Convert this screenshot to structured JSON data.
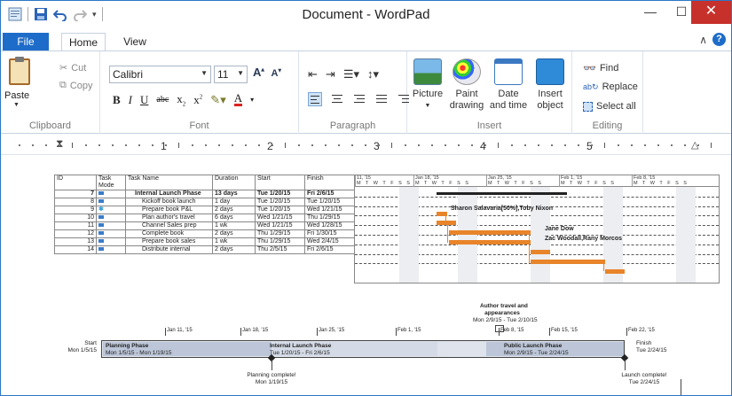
{
  "window": {
    "title": "Document - WordPad"
  },
  "tabs": {
    "file": "File",
    "home": "Home",
    "view": "View"
  },
  "ribbon": {
    "clipboard": {
      "label": "Clipboard",
      "paste": "Paste",
      "cut": "Cut",
      "copy": "Copy"
    },
    "font": {
      "label": "Font",
      "family": "Calibri",
      "size": "11"
    },
    "paragraph": {
      "label": "Paragraph"
    },
    "insert": {
      "label": "Insert",
      "picture": "Picture",
      "paint": "Paint drawing",
      "datetime": "Date and time",
      "object": "Insert object"
    },
    "editing": {
      "label": "Editing",
      "find": "Find",
      "replace": "Replace",
      "selectall": "Select all"
    }
  },
  "ruler": {
    "numbers": [
      "1",
      "2",
      "3",
      "4",
      "5"
    ]
  },
  "gantt": {
    "headers": [
      "ID",
      "Task Mode",
      "Task Name",
      "Duration",
      "Start",
      "Finish"
    ],
    "rows": [
      [
        "7",
        "",
        "Internal Launch Phase",
        "13 days",
        "Tue 1/20/15",
        "Fri 2/6/15"
      ],
      [
        "8",
        "",
        "Kickoff book launch",
        "1 day",
        "Tue 1/20/15",
        "Tue 1/20/15"
      ],
      [
        "9",
        "",
        "Prepare book P&L",
        "2 days",
        "Tue 1/20/15",
        "Wed 1/21/15"
      ],
      [
        "10",
        "",
        "Plan author's travel",
        "6 days",
        "Wed 1/21/15",
        "Thu 1/29/15"
      ],
      [
        "11",
        "",
        "Channel Sales prep",
        "1 wk",
        "Wed 1/21/15",
        "Wed 1/28/15"
      ],
      [
        "12",
        "",
        "Complete book",
        "2 days",
        "Thu 1/29/15",
        "Fri 1/30/15"
      ],
      [
        "13",
        "",
        "Prepare book sales",
        "1 wk",
        "Thu 1/29/15",
        "Wed 2/4/15"
      ],
      [
        "14",
        "",
        "Distribute internal",
        "2 days",
        "Thu 2/5/15",
        "Fri 2/6/15"
      ]
    ],
    "weeks": [
      "11, '15",
      "Jan 18, '15",
      "Jan 25, '15",
      "Feb 1, '15",
      "Feb 8, '15"
    ],
    "day_letters": "M T W T F S S",
    "resources": {
      "r1": "Sharon Salavaria[50%],Toby Nixon",
      "r2": "Jane Dow",
      "r3": "Zac Woodall,Rany Morcos"
    }
  },
  "timeline": {
    "dates": [
      "Jan 11, '15",
      "Jan 18, '15",
      "Jan 25, '15",
      "Feb 1, '15",
      "Feb 8, '15",
      "Feb 15, '15",
      "Feb 22, '15"
    ],
    "start_label": "Start",
    "start_date": "Mon 1/5/15",
    "finish_label": "Finish",
    "finish_date": "Tue 2/24/15",
    "phases": [
      {
        "name": "Planning Phase",
        "dates": "Mon 1/5/15 - Mon 1/19/15"
      },
      {
        "name": "Internal Launch Phase",
        "dates": "Tue 1/20/15 - Fri 2/6/15"
      },
      {
        "name": "Public Launch Phase",
        "dates": "Mon 2/9/15 - Tue 2/24/15"
      }
    ],
    "callout": {
      "title1": "Author travel and",
      "title2": "appearances",
      "dates": "Mon 2/9/15 - Tue 2/10/15"
    },
    "milestones": [
      {
        "name": "Planning complete!",
        "date": "Mon 1/19/15"
      },
      {
        "name": "Launch complete!",
        "date": "Tue 2/24/15"
      }
    ]
  },
  "colors": {
    "accent": "#1e6cc9",
    "bar": "#e8842a",
    "close": "#c7312c"
  }
}
